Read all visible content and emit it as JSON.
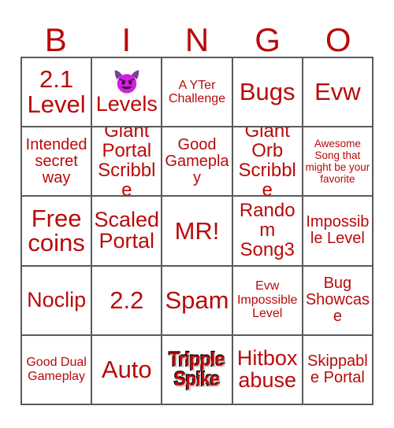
{
  "card": {
    "header_letters": [
      "B",
      "I",
      "N",
      "G",
      "O"
    ],
    "accent_color": "#b90a0a",
    "grid_line_color": "#5a5a5a",
    "background_color": "#ffffff",
    "emoji_color": "#d020e0"
  },
  "cells": [
    {
      "id": "b1",
      "text": "2.1 Level",
      "size": "xxl",
      "style": "plain"
    },
    {
      "id": "i1",
      "text": "Levels",
      "size": "xl",
      "style": "emoji",
      "icon": "smiling-face-with-horns-emoji"
    },
    {
      "id": "n1",
      "text": "A YTer Challenge",
      "size": "sm",
      "style": "plain"
    },
    {
      "id": "g1",
      "text": "Bugs",
      "size": "xxl",
      "style": "plain"
    },
    {
      "id": "o1",
      "text": "Evw",
      "size": "xxl",
      "style": "plain"
    },
    {
      "id": "b2",
      "text": "Intended secret way",
      "size": "md",
      "style": "plain"
    },
    {
      "id": "i2",
      "text": "Giant Portal Scribble",
      "size": "lg",
      "style": "plain"
    },
    {
      "id": "n2",
      "text": "Good Gameplay",
      "size": "md",
      "style": "plain"
    },
    {
      "id": "g2",
      "text": "Giant Orb Scribble",
      "size": "lg",
      "style": "plain"
    },
    {
      "id": "o2",
      "text": "Awesome Song that might be your favorite",
      "size": "xs",
      "style": "plain"
    },
    {
      "id": "b3",
      "text": "Free coins",
      "size": "xxl",
      "style": "plain"
    },
    {
      "id": "i3",
      "text": "Scaled Portal",
      "size": "xl",
      "style": "plain"
    },
    {
      "id": "n3",
      "text": "MR!",
      "size": "xxl",
      "style": "plain"
    },
    {
      "id": "g3",
      "text": "Random Song3",
      "size": "lg",
      "style": "plain"
    },
    {
      "id": "o3",
      "text": "Impossible Level",
      "size": "md",
      "style": "plain"
    },
    {
      "id": "b4",
      "text": "Noclip",
      "size": "xl",
      "style": "plain"
    },
    {
      "id": "i4",
      "text": "2.2",
      "size": "xxl",
      "style": "plain"
    },
    {
      "id": "n4",
      "text": "Spam",
      "size": "xxl",
      "style": "plain"
    },
    {
      "id": "g4",
      "text": "Evw Impossible Level",
      "size": "sm",
      "style": "plain"
    },
    {
      "id": "o4",
      "text": "Bug Showcase",
      "size": "md",
      "style": "plain"
    },
    {
      "id": "b5",
      "text": "Good Dual Gameplay",
      "size": "sm",
      "style": "plain"
    },
    {
      "id": "i5",
      "text": "Auto",
      "size": "xxl",
      "style": "plain"
    },
    {
      "id": "n5",
      "text": "Tripple Spike",
      "size": "lg",
      "style": "outlined"
    },
    {
      "id": "g5",
      "text": "Hitbox abuse",
      "size": "xl",
      "style": "plain"
    },
    {
      "id": "o5",
      "text": "Skippable Portal",
      "size": "md",
      "style": "plain"
    }
  ]
}
